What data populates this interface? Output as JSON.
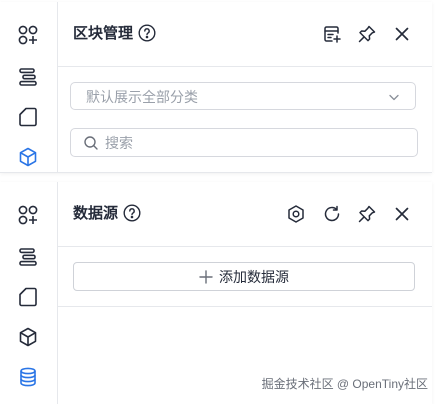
{
  "block_panel": {
    "title": "区块管理",
    "select_value": "默认展示全部分类",
    "search_placeholder": "搜索",
    "rail_icons": [
      "components-icon",
      "outline-icon",
      "page-icon",
      "block-icon"
    ],
    "active_rail": "block-icon",
    "header_icons": [
      "add-category-icon",
      "pin-icon",
      "close-icon"
    ]
  },
  "datasource_panel": {
    "title": "数据源",
    "add_label": "添加数据源",
    "rail_icons": [
      "components-icon",
      "outline-icon",
      "page-icon",
      "block-icon",
      "datasource-icon"
    ],
    "active_rail": "datasource-icon",
    "header_icons": [
      "settings-icon",
      "refresh-icon",
      "pin-icon",
      "close-icon"
    ]
  },
  "watermark": "掘金技术社区 @ OpenTiny社区",
  "colors": {
    "accent": "#2a75e6",
    "icon": "#252b3a",
    "border": "#e6e8ec"
  }
}
